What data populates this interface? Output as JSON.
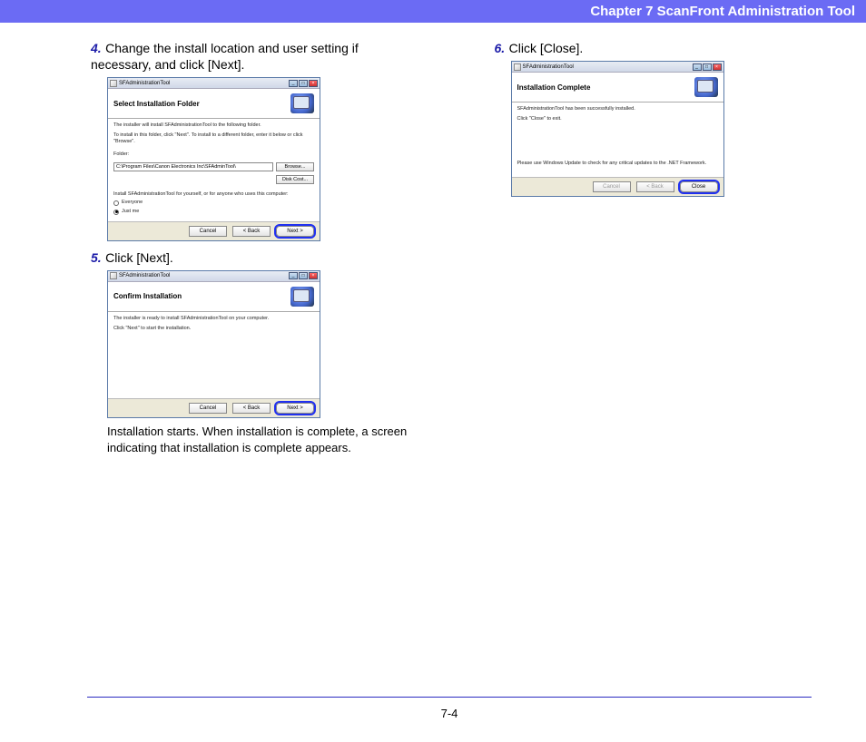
{
  "header": {
    "chapter_title": "Chapter 7   ScanFront Administration Tool"
  },
  "leftcol": {
    "step4": {
      "num": "4.",
      "text": "Change the install location and user setting if necessary, and click [Next].",
      "dialog": {
        "app_title": "SFAdministrationTool",
        "heading": "Select Installation Folder",
        "body_line1": "The installer will install SFAdministrationTool to the following folder.",
        "body_line2": "To install in this folder, click \"Next\". To install to a different folder, enter it below or click \"Browse\".",
        "folder_label": "Folder:",
        "folder_value": "C:\\Program Files\\Canon Electronics Inc\\SFAdminTool\\",
        "browse_btn": "Browse...",
        "diskcost_btn": "Disk Cost...",
        "scope_label": "Install SFAdministrationTool for yourself, or for anyone who uses this computer:",
        "radio_everyone": "Everyone",
        "radio_justme": "Just me",
        "cancel_btn": "Cancel",
        "back_btn": "< Back",
        "next_btn": "Next >"
      }
    },
    "step5": {
      "num": "5.",
      "text": "Click [Next].",
      "dialog": {
        "app_title": "SFAdministrationTool",
        "heading": "Confirm Installation",
        "body_line1": "The installer is ready to install SFAdministrationTool on your computer.",
        "body_line2": "Click \"Next\" to start the installation.",
        "cancel_btn": "Cancel",
        "back_btn": "< Back",
        "next_btn": "Next >"
      },
      "after_text": "Installation starts. When installation is complete, a screen indicating that installation is complete appears."
    }
  },
  "rightcol": {
    "step6": {
      "num": "6.",
      "text": "Click [Close].",
      "dialog": {
        "app_title": "SFAdministrationTool",
        "heading": "Installation Complete",
        "body_line1": "SFAdministrationTool has been successfully installed.",
        "body_line2": "Click \"Close\" to exit.",
        "footer_note": "Please use Windows Update to check for any critical updates to the .NET Framework.",
        "cancel_btn": "Cancel",
        "back_btn": "< Back",
        "close_btn": "Close"
      }
    }
  },
  "footer": {
    "page_num": "7-4"
  }
}
